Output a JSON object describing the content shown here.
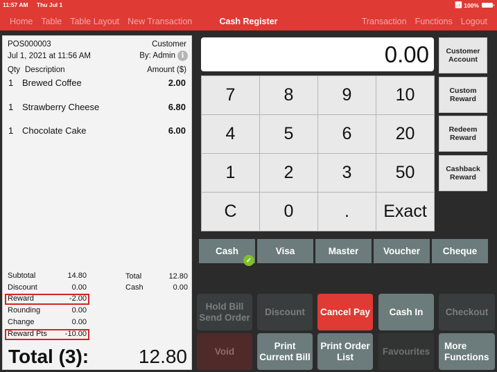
{
  "status_bar": {
    "time": "11:57 AM",
    "date": "Thu Jul 1",
    "battery": "100%"
  },
  "header": {
    "title": "Cash Register",
    "nav_left": [
      "Home",
      "Table",
      "Table Layout",
      "New Transaction"
    ],
    "nav_right": [
      "Transaction",
      "Functions",
      "Logout"
    ]
  },
  "receipt": {
    "order_id": "POS000003",
    "customer_label": "Customer",
    "datetime": "Jul 1, 2021 at 11:56 AM",
    "by": "By: Admin",
    "info_icon": "i",
    "columns": {
      "qty": "Qty",
      "description": "Description",
      "amount": "Amount ($)"
    },
    "items": [
      {
        "qty": "1",
        "description": "Brewed Coffee",
        "amount": "2.00"
      },
      {
        "qty": "1",
        "description": "Strawberry Cheese",
        "amount": "6.80"
      },
      {
        "qty": "1",
        "description": "Chocolate Cake",
        "amount": "6.00"
      }
    ],
    "summary_left": [
      {
        "label": "Subtotal",
        "value": "14.80",
        "highlighted": false
      },
      {
        "label": "Discount",
        "value": "0.00",
        "highlighted": false
      },
      {
        "label": "Reward",
        "value": "-2.00",
        "highlighted": true
      },
      {
        "label": "Rounding",
        "value": "0.00",
        "highlighted": false
      },
      {
        "label": "Change",
        "value": "0.00",
        "highlighted": false
      },
      {
        "label": "Reward Pts",
        "value": "-10.00",
        "highlighted": true
      }
    ],
    "summary_right": [
      {
        "label": "Total",
        "value": "12.80"
      },
      {
        "label": "Cash",
        "value": "0.00"
      }
    ],
    "grand_total_label": "Total (3):",
    "grand_total_value": "12.80"
  },
  "display": {
    "value": "0.00"
  },
  "keypad": [
    "7",
    "8",
    "9",
    "10",
    "4",
    "5",
    "6",
    "20",
    "1",
    "2",
    "3",
    "50",
    "C",
    "0",
    ".",
    "Exact"
  ],
  "side_buttons": [
    {
      "line1": "Customer",
      "line2": "Account"
    },
    {
      "line1": "Custom",
      "line2": "Reward"
    },
    {
      "line1": "Redeem",
      "line2": "Reward"
    },
    {
      "line1": "Cashback",
      "line2": "Reward"
    }
  ],
  "payment_methods": [
    {
      "label": "Cash",
      "selected": true
    },
    {
      "label": "Visa",
      "selected": false
    },
    {
      "label": "Master",
      "selected": false
    },
    {
      "label": "Voucher",
      "selected": false
    },
    {
      "label": "Cheque",
      "selected": false
    }
  ],
  "payment_selected_icon": "✓",
  "actions": {
    "hold_bill": {
      "line1": "Hold Bill",
      "line2": "Send Order"
    },
    "discount": "Discount",
    "cancel_pay": "Cancel Pay",
    "cash_in": "Cash In",
    "checkout": "Checkout",
    "void": "Void",
    "print_current_bill": {
      "line1": "Print",
      "line2": "Current Bill"
    },
    "print_order_list": {
      "line1": "Print Order",
      "line2": "List"
    },
    "favourites": "Favourites",
    "more_functions": {
      "line1": "More",
      "line2": "Functions"
    }
  },
  "colors": {
    "brand_red": "#df3a34",
    "slate": "#6c7b7b",
    "success_green": "#7fbf2a",
    "highlight_border": "#d62222"
  }
}
